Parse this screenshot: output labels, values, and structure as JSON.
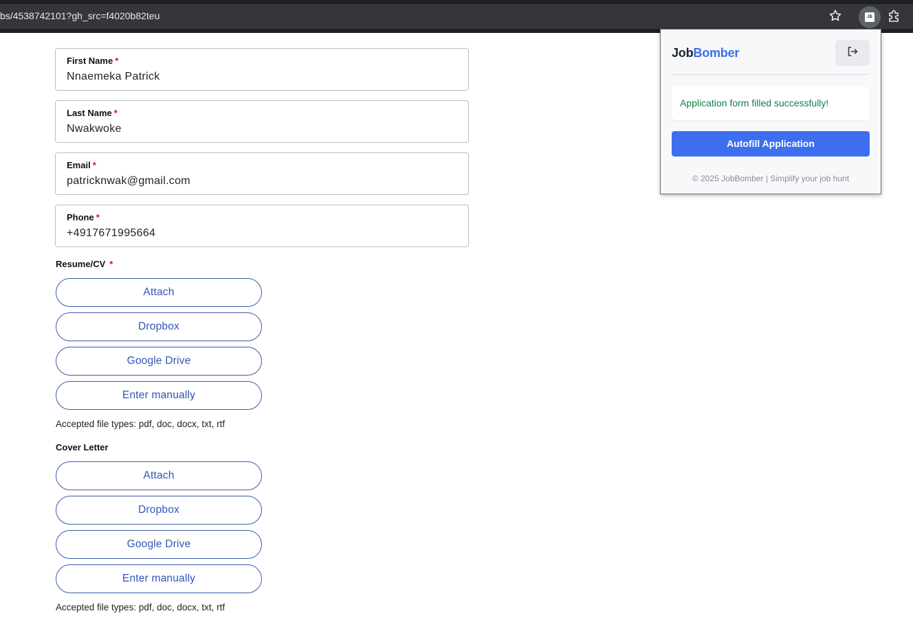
{
  "browser": {
    "url": "bs/4538742101?gh_src=f4020b82teu",
    "icons": {
      "bookmark": "star-icon",
      "extension_active": "jobbomber-extension-icon",
      "extensions": "puzzle-icon"
    }
  },
  "form": {
    "fields": [
      {
        "label": "First Name",
        "required_mark": "*",
        "value": "Nnaemeka Patrick"
      },
      {
        "label": "Last Name",
        "required_mark": "*",
        "value": "Nwakwoke"
      },
      {
        "label": "Email",
        "required_mark": "*",
        "value": "patricknwak@gmail.com"
      },
      {
        "label": "Phone",
        "required_mark": "*",
        "value": "+4917671995664"
      }
    ],
    "resume": {
      "label": "Resume/CV",
      "required_mark": "*",
      "buttons": [
        "Attach",
        "Dropbox",
        "Google Drive",
        "Enter manually"
      ],
      "hint": "Accepted file types: pdf, doc, docx, txt, rtf"
    },
    "cover_letter": {
      "label": "Cover Letter",
      "buttons": [
        "Attach",
        "Dropbox",
        "Google Drive",
        "Enter manually"
      ],
      "hint": "Accepted file types: pdf, doc, docx, txt, rtf"
    }
  },
  "popup": {
    "logo_part1": "Job",
    "logo_part2": "Bomber",
    "logout_icon": "logout-icon",
    "success_message": "Application form filled successfully!",
    "autofill_button": "Autofill Application",
    "footer": "© 2025 JobBomber | Simplify your job hunt"
  },
  "colors": {
    "accent": "#3d6ef0",
    "brand_blue": "#3c6ee8",
    "success": "#13804a",
    "link_blue": "#2f55b5",
    "required": "#dd1111"
  }
}
